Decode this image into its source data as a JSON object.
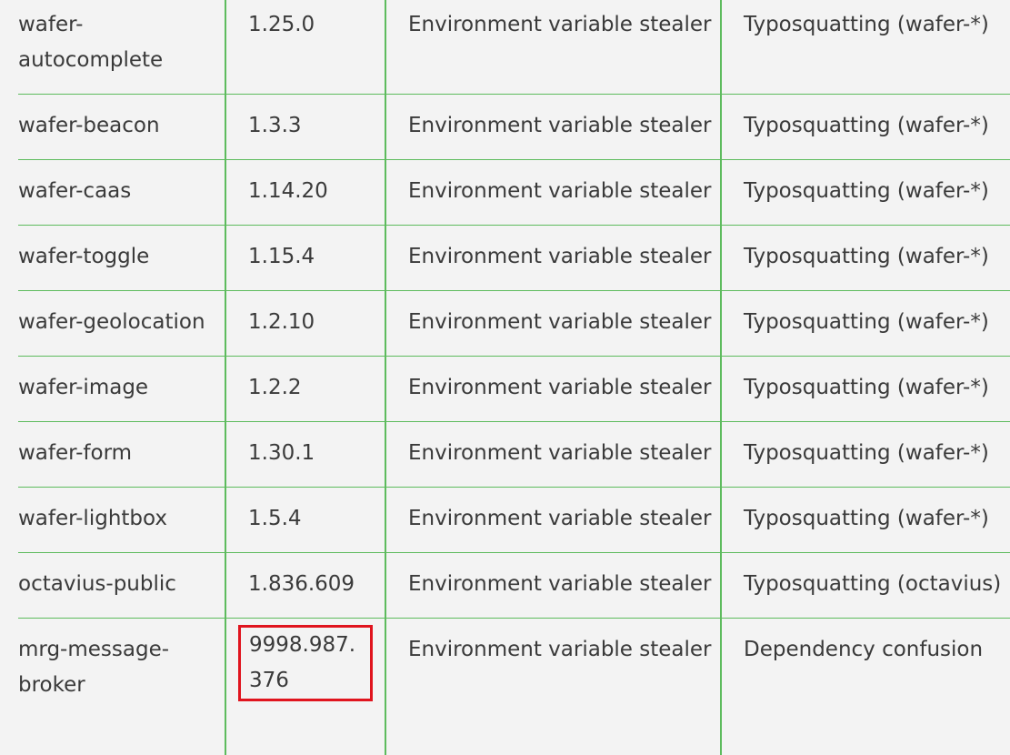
{
  "table": {
    "rows": [
      [
        "wafer-autocomplete",
        "1.25.0",
        "Environment variable stealer",
        "Typosquatting (wafer-*)"
      ],
      [
        "wafer-beacon",
        "1.3.3",
        "Environment variable stealer",
        "Typosquatting (wafer-*)"
      ],
      [
        "wafer-caas",
        "1.14.20",
        "Environment variable stealer",
        "Typosquatting (wafer-*)"
      ],
      [
        "wafer-toggle",
        "1.15.4",
        "Environment variable stealer",
        "Typosquatting (wafer-*)"
      ],
      [
        "wafer-geolocation",
        "1.2.10",
        "Environment variable stealer",
        "Typosquatting (wafer-*)"
      ],
      [
        "wafer-image",
        "1.2.2",
        "Environment variable stealer",
        "Typosquatting (wafer-*)"
      ],
      [
        "wafer-form",
        "1.30.1",
        "Environment variable stealer",
        "Typosquatting (wafer-*)"
      ],
      [
        "wafer-lightbox",
        "1.5.4",
        "Environment variable stealer",
        "Typosquatting (wafer-*)"
      ],
      [
        "octavius-public",
        "1.836.609",
        "Environment variable stealer",
        "Typosquatting (octavius)"
      ],
      [
        "mrg-message-broker",
        "9998.987.376",
        "Environment variable stealer",
        "Dependency confusion"
      ]
    ],
    "highlight": {
      "row": 9,
      "col": 1,
      "color": "#e0141e"
    },
    "colors": {
      "border": "#5dbb5d",
      "background": "#f3f3f3",
      "text": "#3a3a3a"
    }
  }
}
